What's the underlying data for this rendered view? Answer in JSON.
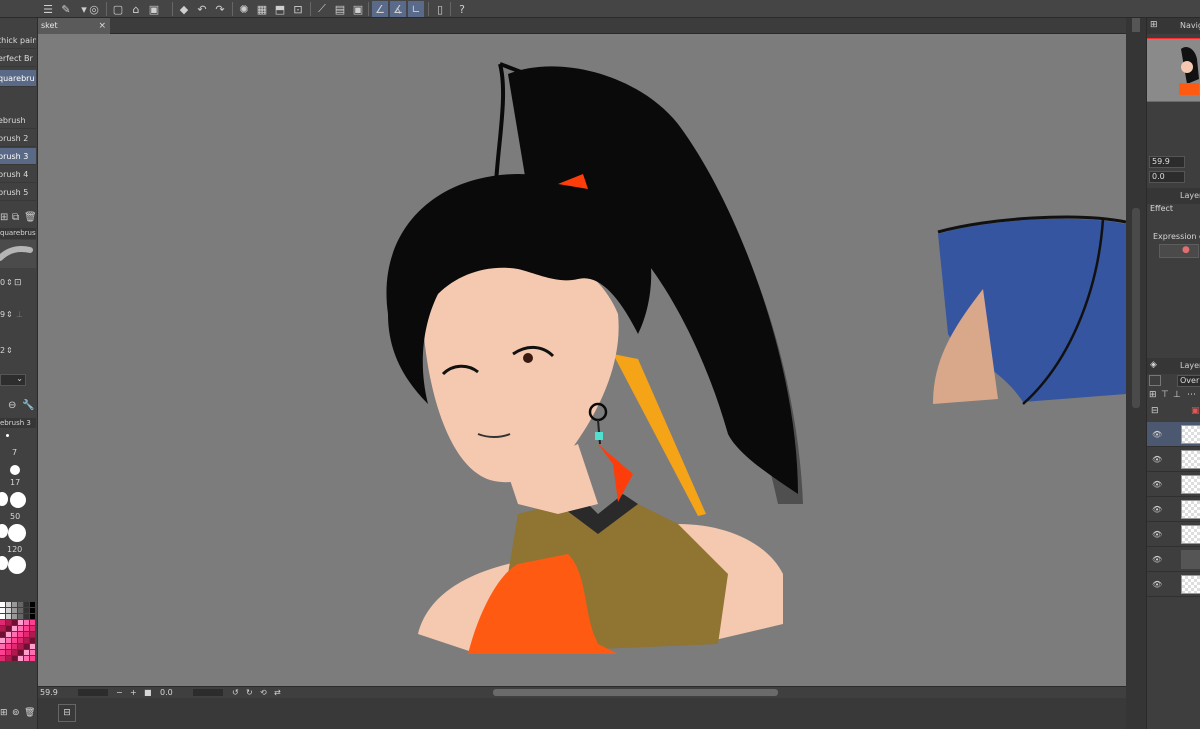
{
  "document": {
    "tab_name": "sket",
    "close_glyph": "×"
  },
  "brush_list": {
    "items": [
      "thick paint",
      "erfect Br",
      "quarebru",
      "ebrush",
      "brush 2",
      "brush 3",
      "brush 4",
      "brush 5"
    ],
    "selected_index": 2,
    "sub_selected_index": 5,
    "preview_label": "quarebrush",
    "size_values": [
      "0",
      "9",
      "2"
    ]
  },
  "brush_size": {
    "title": "ebrush 3",
    "sizes": [
      "7",
      "17",
      "50",
      "120"
    ]
  },
  "navigator": {
    "title": "Navig",
    "zoom": "59.9",
    "rotation": "0.0"
  },
  "layer_property": {
    "title": "Layer",
    "effect_label": "Effect",
    "expression_label": "Expression co"
  },
  "layers_panel": {
    "title": "Layer",
    "blend_mode": "Overl",
    "row_count": 7
  },
  "status": {
    "zoom": "59.9",
    "rotation": "0.0"
  },
  "colors": {
    "accent": "#5a6985",
    "canvas": "#7c7c7c",
    "hair": "#0a0a0a",
    "skin": "#f5c9b0",
    "orange": "#ff5a12",
    "gold": "#8f7432",
    "blue": "#3555a0"
  }
}
